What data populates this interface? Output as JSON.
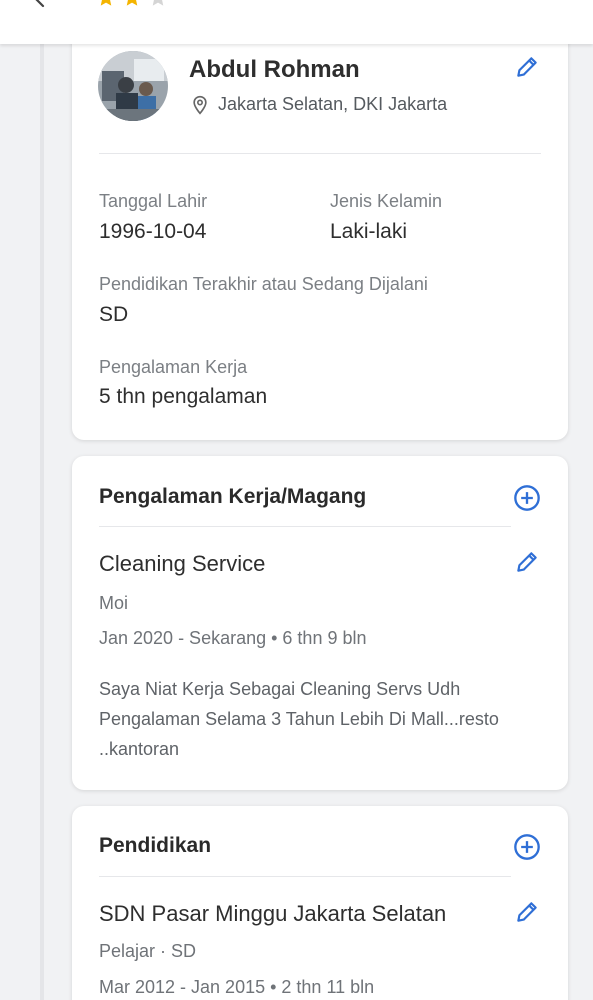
{
  "profile": {
    "name": "Abdul Rohman",
    "location": "Jakarta Selatan, DKI Jakarta",
    "birth_label": "Tanggal Lahir",
    "birth_value": "1996-10-04",
    "gender_label": "Jenis Kelamin",
    "gender_value": "Laki-laki",
    "education_label": "Pendidikan Terakhir atau Sedang Dijalani",
    "education_value": "SD",
    "experience_label": "Pengalaman Kerja",
    "experience_value": "5 thn  pengalaman"
  },
  "rating": {
    "filled": 2,
    "total": 3,
    "star_color": "#f4b400",
    "empty_color": "#d5d5d5"
  },
  "experience": {
    "title": "Pengalaman Kerja/Magang",
    "items": [
      {
        "position": "Cleaning Service",
        "company": "Moi",
        "period": "Jan 2020 - Sekarang • 6 thn 9 bln",
        "description": "Saya Niat Kerja Sebagai Cleaning Servs Udh Pengalaman Selama 3 Tahun Lebih Di Mall...resto ..kantoran"
      }
    ]
  },
  "education": {
    "title": "Pendidikan",
    "items": [
      {
        "school": "SDN Pasar Minggu Jakarta Selatan",
        "level": "Pelajar · SD",
        "period": "Mar 2012 - Jan 2015 • 2 thn 11 bln"
      }
    ]
  },
  "colors": {
    "accent": "#2f6fd6",
    "text": "#2e2e2e",
    "muted": "#7b7f84"
  },
  "icons": [
    "back-arrow-icon",
    "star-icon",
    "location-pin-icon",
    "pencil-edit-icon",
    "plus-circle-icon"
  ]
}
